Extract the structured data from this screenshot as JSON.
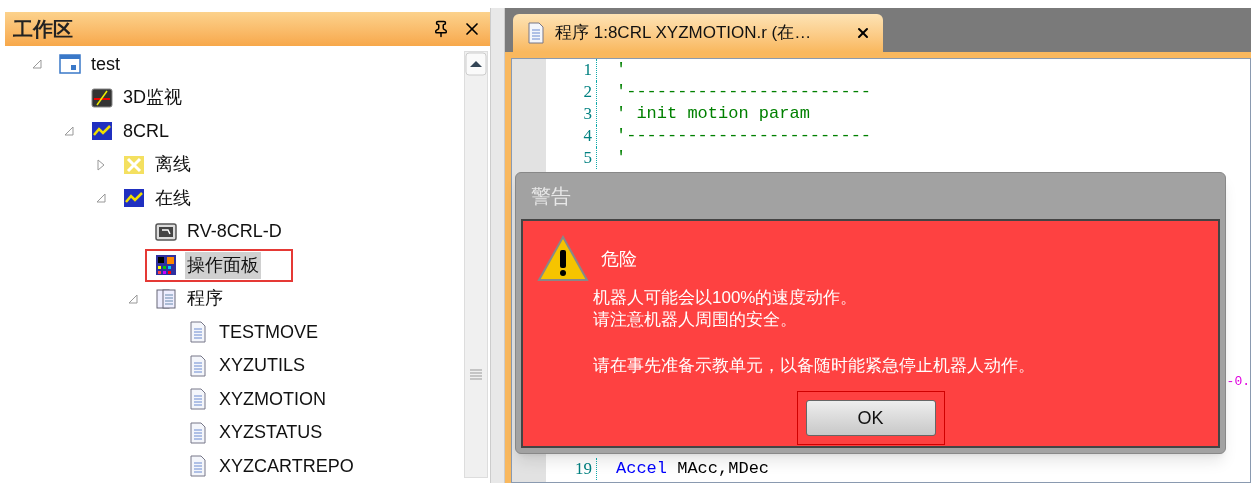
{
  "workspace": {
    "title": "工作区"
  },
  "tree": [
    {
      "label": "test",
      "kind": "project",
      "expanded": true,
      "selected": false,
      "marked": false,
      "children": [
        {
          "label": "3D监视",
          "kind": "monitor",
          "selected": false,
          "marked": false
        },
        {
          "label": "8CRL",
          "kind": "wave",
          "expanded": true,
          "selected": false,
          "marked": false,
          "children": [
            {
              "label": "离线",
              "kind": "offline",
              "expanded": false,
              "selected": false,
              "marked": false
            },
            {
              "label": "在线",
              "kind": "wave",
              "expanded": true,
              "selected": false,
              "marked": false,
              "children": [
                {
                  "label": "RV-8CRL-D",
                  "kind": "robot",
                  "selected": false,
                  "marked": false
                },
                {
                  "label": "操作面板",
                  "kind": "panel",
                  "selected": true,
                  "marked": true
                },
                {
                  "label": "程序",
                  "kind": "programs",
                  "expanded": true,
                  "selected": false,
                  "marked": false,
                  "children": [
                    {
                      "label": "TESTMOVE",
                      "kind": "file",
                      "selected": false,
                      "marked": false
                    },
                    {
                      "label": "XYZUTILS",
                      "kind": "file",
                      "selected": false,
                      "marked": false
                    },
                    {
                      "label": "XYZMOTION",
                      "kind": "file",
                      "selected": false,
                      "marked": false
                    },
                    {
                      "label": "XYZSTATUS",
                      "kind": "file",
                      "selected": false,
                      "marked": false
                    },
                    {
                      "label": "XYZCARTREPO",
                      "kind": "file",
                      "selected": false,
                      "marked": false
                    }
                  ]
                }
              ]
            }
          ]
        }
      ]
    }
  ],
  "editor": {
    "tab": {
      "title": "程序 1:8CRL XYZMOTION.r (在…",
      "selected": true
    },
    "lines_top": [
      {
        "number": "1",
        "segments": [
          {
            "kind": "comment",
            "text": "'"
          }
        ]
      },
      {
        "number": "2",
        "segments": [
          {
            "kind": "comment",
            "text": "'------------------------"
          }
        ]
      },
      {
        "number": "3",
        "segments": [
          {
            "kind": "comment",
            "text": "' init motion param"
          }
        ]
      },
      {
        "number": "4",
        "segments": [
          {
            "kind": "comment",
            "text": "'------------------------"
          }
        ]
      },
      {
        "number": "5",
        "segments": [
          {
            "kind": "comment",
            "text": "'"
          }
        ]
      }
    ],
    "lines_bottom": [
      {
        "number": "19",
        "segments": [
          {
            "kind": "keyword",
            "text": "Accel"
          },
          {
            "kind": "plain",
            "text": " MAcc,MDec"
          }
        ]
      }
    ],
    "right_fragment": {
      "kind": "number",
      "text": "-0."
    }
  },
  "dialog": {
    "title": "警告",
    "heading": "危险",
    "lines": [
      "机器人可能会以100%的速度动作。",
      "请注意机器人周围的安全。"
    ],
    "note": "请在事先准备示教单元，以备随时能紧急停止机器人动作。",
    "button": {
      "label": "OK",
      "marked": true
    }
  }
}
